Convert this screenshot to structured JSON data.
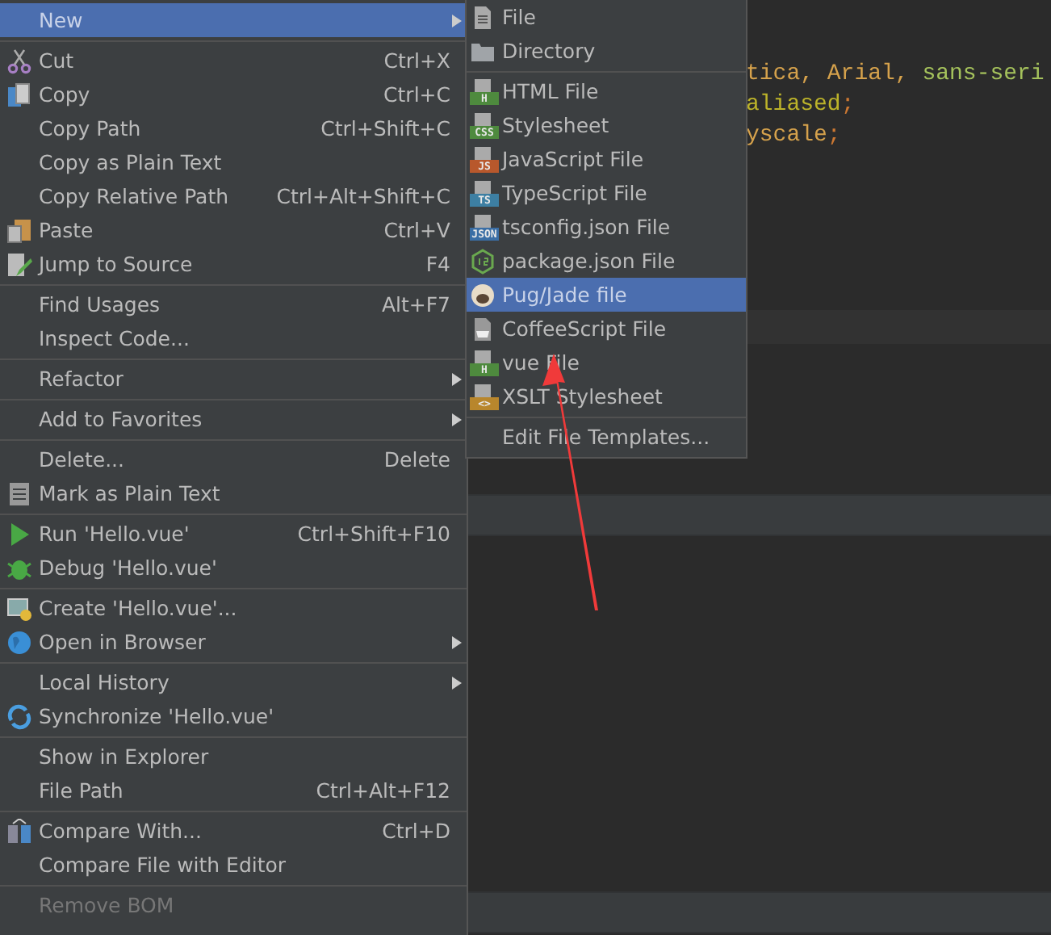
{
  "context_menu": {
    "groups": [
      [
        {
          "label": "New",
          "submenu": true,
          "selected": true,
          "disabled": false
        }
      ],
      [
        {
          "label": "Cut",
          "shortcut": "Ctrl+X",
          "submenu": false,
          "selected": false,
          "disabled": false
        },
        {
          "label": "Copy",
          "shortcut": "Ctrl+C",
          "submenu": false,
          "selected": false,
          "disabled": false
        },
        {
          "label": "Copy Path",
          "shortcut": "Ctrl+Shift+C",
          "submenu": false,
          "selected": false,
          "disabled": false
        },
        {
          "label": "Copy as Plain Text",
          "submenu": false,
          "selected": false,
          "disabled": false
        },
        {
          "label": "Copy Relative Path",
          "shortcut": "Ctrl+Alt+Shift+C",
          "submenu": false,
          "selected": false,
          "disabled": false
        },
        {
          "label": "Paste",
          "shortcut": "Ctrl+V",
          "submenu": false,
          "selected": false,
          "disabled": false
        },
        {
          "label": "Jump to Source",
          "shortcut": "F4",
          "submenu": false,
          "selected": false,
          "disabled": false
        }
      ],
      [
        {
          "label": "Find Usages",
          "shortcut": "Alt+F7",
          "submenu": false,
          "selected": false,
          "disabled": false
        },
        {
          "label": "Inspect Code...",
          "submenu": false,
          "selected": false,
          "disabled": false
        }
      ],
      [
        {
          "label": "Refactor",
          "submenu": true,
          "selected": false,
          "disabled": false
        }
      ],
      [
        {
          "label": "Add to Favorites",
          "submenu": true,
          "selected": false,
          "disabled": false
        }
      ],
      [
        {
          "label": "Delete...",
          "shortcut": "Delete",
          "submenu": false,
          "selected": false,
          "disabled": false
        },
        {
          "label": "Mark as Plain Text",
          "submenu": false,
          "selected": false,
          "disabled": false
        }
      ],
      [
        {
          "label": "Run 'Hello.vue'",
          "shortcut": "Ctrl+Shift+F10",
          "submenu": false,
          "selected": false,
          "disabled": false
        },
        {
          "label": "Debug 'Hello.vue'",
          "submenu": false,
          "selected": false,
          "disabled": false
        }
      ],
      [
        {
          "label": "Create 'Hello.vue'...",
          "submenu": false,
          "selected": false,
          "disabled": false
        },
        {
          "label": "Open in Browser",
          "submenu": true,
          "selected": false,
          "disabled": false
        }
      ],
      [
        {
          "label": "Local History",
          "submenu": true,
          "selected": false,
          "disabled": false
        },
        {
          "label": "Synchronize 'Hello.vue'",
          "submenu": false,
          "selected": false,
          "disabled": false
        }
      ],
      [
        {
          "label": "Show in Explorer",
          "submenu": false,
          "selected": false,
          "disabled": false
        },
        {
          "label": "File Path",
          "shortcut": "Ctrl+Alt+F12",
          "submenu": false,
          "selected": false,
          "disabled": false
        }
      ],
      [
        {
          "label": "Compare With...",
          "shortcut": "Ctrl+D",
          "submenu": false,
          "selected": false,
          "disabled": false
        },
        {
          "label": "Compare File with Editor",
          "submenu": false,
          "selected": false,
          "disabled": false
        }
      ],
      [
        {
          "label": "Remove BOM",
          "submenu": false,
          "selected": false,
          "disabled": true
        }
      ]
    ]
  },
  "new_submenu": {
    "groups": [
      [
        {
          "label": "File",
          "selected": false
        },
        {
          "label": "Directory",
          "selected": false
        }
      ],
      [
        {
          "label": "HTML File",
          "badge": "H",
          "color": "#4e8a3e",
          "selected": false
        },
        {
          "label": "Stylesheet",
          "badge": "CSS",
          "color": "#4e8a3e",
          "selected": false
        },
        {
          "label": "JavaScript File",
          "badge": "JS",
          "color": "#b8582c",
          "selected": false
        },
        {
          "label": "TypeScript File",
          "badge": "TS",
          "color": "#3d7fa3",
          "selected": false
        },
        {
          "label": "tsconfig.json File",
          "badge": "JSON",
          "color": "#3a6ea5",
          "selected": false
        },
        {
          "label": "package.json File",
          "selected": false
        },
        {
          "label": "Pug/Jade file",
          "selected": true
        },
        {
          "label": "CoffeeScript File",
          "selected": false
        },
        {
          "label": "vue File",
          "badge": "H",
          "color": "#4e8a3e",
          "selected": false
        },
        {
          "label": "XSLT Stylesheet",
          "badge": "<>",
          "color": "#b8862c",
          "selected": false
        }
      ],
      [
        {
          "label": "Edit File Templates...",
          "selected": false
        }
      ]
    ]
  },
  "editor": {
    "code_lines": [
      [
        {
          "text": "tica, Arial, ",
          "color": "#d6a24c"
        },
        {
          "text": "sans-seri",
          "color": "#a5c25c"
        }
      ],
      [
        {
          "text": "aliased",
          "color": "#bcb32a"
        },
        {
          "text": ";",
          "color": "#cc7832"
        }
      ],
      [
        {
          "text": "yscale",
          "color": "#d6a24c"
        },
        {
          "text": ";",
          "color": "#cc7832"
        }
      ]
    ]
  }
}
